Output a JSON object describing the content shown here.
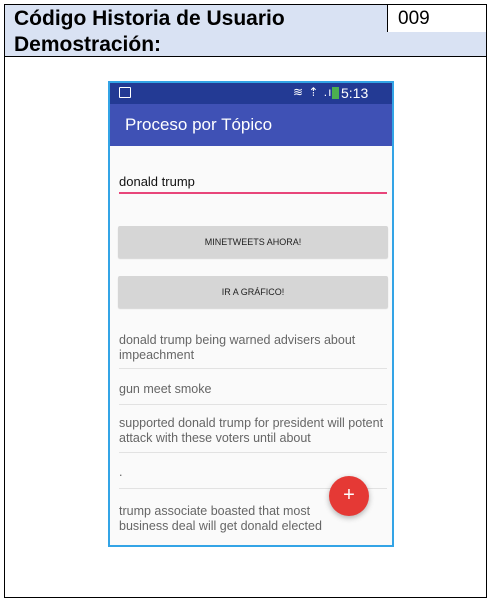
{
  "document": {
    "title_label": "Código Historia de Usuario",
    "code_value": "009",
    "section_label": "Demostración:"
  },
  "phone": {
    "status": {
      "time": "5:13 PM",
      "icons": "≋ ⇡ .ıl"
    },
    "appbar_title": "Proceso por Tópico",
    "search_input": "donald trump",
    "buttons": {
      "mine": "MINETWEETS AHORA!",
      "chart": "IR A GRÁFICO!"
    },
    "results": [
      "donald trump being warned advisers about impeachment",
      "gun meet smoke",
      "supported donald trump for president will potent attack with these voters until about",
      ".",
      "trump associate boasted that most business deal will get donald elected"
    ],
    "fab_symbol": "+"
  }
}
